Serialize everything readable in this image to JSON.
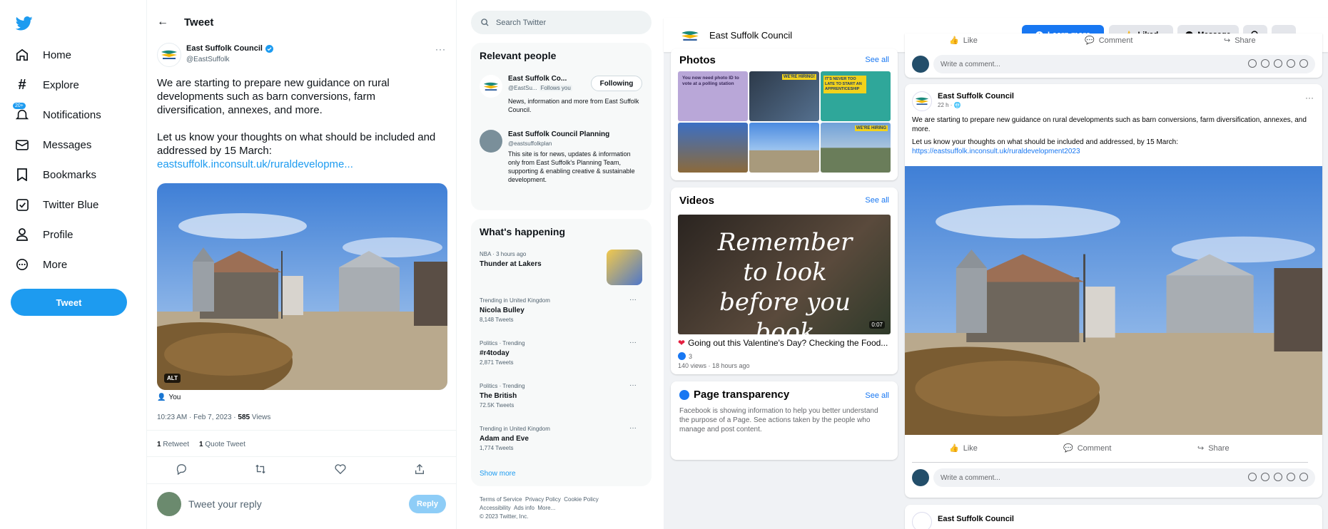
{
  "twitter": {
    "nav": {
      "items": [
        {
          "label": "Home",
          "icon": "home-icon"
        },
        {
          "label": "Explore",
          "icon": "hash-icon"
        },
        {
          "label": "Notifications",
          "icon": "bell-icon",
          "badge": "20+"
        },
        {
          "label": "Messages",
          "icon": "mail-icon"
        },
        {
          "label": "Bookmarks",
          "icon": "bookmark-icon"
        },
        {
          "label": "Twitter Blue",
          "icon": "blue-icon"
        },
        {
          "label": "Profile",
          "icon": "person-icon"
        },
        {
          "label": "More",
          "icon": "more-circle-icon"
        }
      ],
      "tweet_button": "Tweet"
    },
    "tweet": {
      "header_title": "Tweet",
      "author_name": "East Suffolk Council",
      "author_handle": "@EastSuffolk",
      "text_p1": "We are starting to prepare new guidance on rural developments such as barn conversions, farm diversification, annexes, and more.",
      "text_p2": "Let us know your thoughts on what should be included and addressed by 15 March:",
      "link": "eastsuffolk.inconsult.uk/ruraldevelopme...",
      "alt_badge": "ALT",
      "tagged": "You",
      "timestamp": "10:23 AM · Feb 7, 2023 · ",
      "views_count": "585",
      "views_label": " Views",
      "retweets_count": "1",
      "retweets_label": " Retweet",
      "quotes_count": "1",
      "quotes_label": " Quote Tweet",
      "reply_placeholder": "Tweet your reply",
      "reply_button": "Reply"
    },
    "search_placeholder": "Search Twitter",
    "relevant": {
      "title": "Relevant people",
      "people": [
        {
          "name": "East Suffolk Co...",
          "handle": "@EastSu...",
          "follows_you": "Follows you",
          "button": "Following",
          "bio": "News, information and more from East Suffolk Council."
        },
        {
          "name": "East Suffolk Council Planning",
          "handle": "@eastsuffolkplan",
          "bio": "This site is for news, updates & information only from East Suffolk's Planning Team, supporting & enabling creative & sustainable development."
        }
      ]
    },
    "happening": {
      "title": "What's happening",
      "items": [
        {
          "context": "NBA · 3 hours ago",
          "topic": "Thunder at Lakers",
          "count": ""
        },
        {
          "context": "Trending in United Kingdom",
          "topic": "Nicola Bulley",
          "count": "8,148 Tweets"
        },
        {
          "context": "Politics · Trending",
          "topic": "#r4today",
          "count": "2,871 Tweets"
        },
        {
          "context": "Politics · Trending",
          "topic": "The British",
          "count": "72.5K Tweets"
        },
        {
          "context": "Trending in United Kingdom",
          "topic": "Adam and Eve",
          "count": "1,774 Tweets"
        }
      ],
      "show_more": "Show more"
    },
    "footer": {
      "line1": [
        "Terms of Service",
        "Privacy Policy",
        "Cookie Policy"
      ],
      "line2": [
        "Accessibility",
        "Ads info",
        "More..."
      ],
      "copyright": "© 2023 Twitter, Inc."
    },
    "brand_color": "#1d9bf0"
  },
  "facebook": {
    "page_name": "East Suffolk Council",
    "buttons": {
      "learn_more": "Learn more",
      "liked": "Liked",
      "message": "Message"
    },
    "photos": {
      "title": "Photos",
      "see_all": "See all"
    },
    "photo_captions": {
      "id": "You now need photo ID to vote at a polling station",
      "hiring": "WE'RE HIRING!",
      "apprentice": "IT'S NEVER TOO LATE TO START AN APPRENTICESHIP",
      "hiring2": "WE'RE HIRING"
    },
    "videos": {
      "title": "Videos",
      "see_all": "See all",
      "overlay": "Remember to look before you book",
      "duration": "0:07",
      "caption": "Going out this Valentine's Day? Checking the Food...",
      "reactions": "3",
      "meta": "140 views · 18 hours ago"
    },
    "transparency": {
      "title": "Page transparency",
      "see_all": "See all",
      "text": "Facebook is showing information to help you better understand the purpose of a Page. See actions taken by the people who manage and post content."
    },
    "post": {
      "author": "East Suffolk Council",
      "meta": "22 h · ",
      "text_p1": "We are starting to prepare new guidance on rural developments such as barn conversions, farm diversification, annexes, and more.",
      "text_p2": "Let us know your thoughts on what should be included and addressed, by 15 March:",
      "link": "https://eastsuffolk.inconsult.uk/ruraldevelopment2023",
      "like": "Like",
      "comment": "Comment",
      "share": "Share",
      "comment_placeholder": "Write a comment..."
    },
    "top_actions": {
      "like": "Like",
      "comment": "Comment",
      "share": "Share"
    },
    "next_post_author": "East Suffolk Council",
    "brand_color": "#1877f2"
  }
}
